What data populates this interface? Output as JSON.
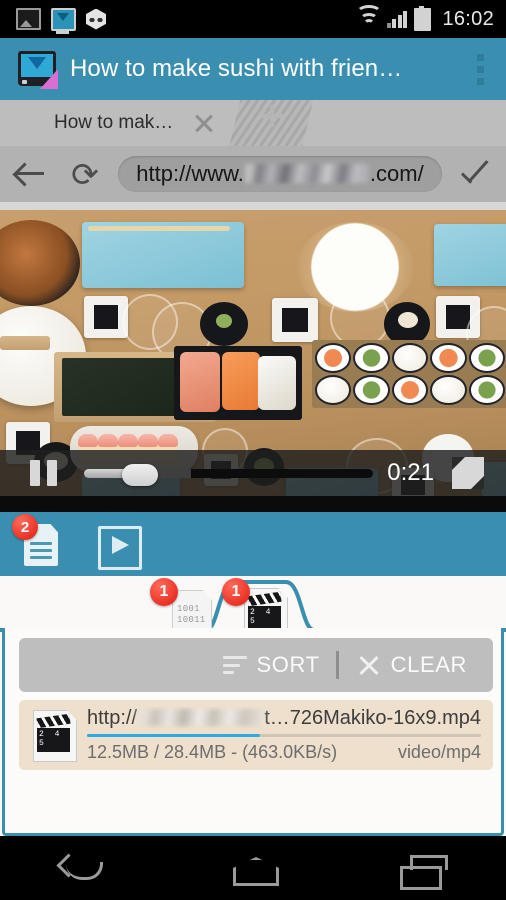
{
  "status_bar": {
    "time": "16:02",
    "icons": [
      "photo-icon",
      "screen-recorder-icon",
      "hexagon-face-icon",
      "wifi-icon",
      "signal-icon",
      "battery-icon"
    ]
  },
  "app_header": {
    "title": "How to make sushi with frien…",
    "logo_icon": "video-downloader-logo",
    "overflow_icon": "overflow-menu-icon",
    "bg_color": "#3a8fb0"
  },
  "browser": {
    "tab": {
      "label": "How to mak…",
      "close_icon": "close-icon"
    },
    "new_tab_icon": "plus-icon",
    "url_bar": {
      "back_icon": "back-arrow-icon",
      "reload_icon": "reload-icon",
      "url_prefix": "http://www.",
      "url_suffix": ".com/",
      "go_icon": "check-icon"
    }
  },
  "video": {
    "pause_icon": "pause-icon",
    "time": "0:21",
    "fullscreen_icon": "fullscreen-icon",
    "progress_percent": 17,
    "buffer_percent": 37
  },
  "action_bar": {
    "documents_icon": "document-list-icon",
    "documents_badge": "2",
    "play_icon": "play-box-icon"
  },
  "download_tabs": [
    {
      "icon": "binary-file-icon",
      "icon_text": "1001\n10011",
      "badge": "1",
      "active": false
    },
    {
      "icon": "movie-file-icon",
      "badge": "1",
      "active": true
    }
  ],
  "download_toolbar": {
    "sort_label": "SORT",
    "sort_icon": "sort-icon",
    "clear_label": "CLEAR",
    "clear_icon": "clear-x-icon"
  },
  "downloads": [
    {
      "icon": "movie-file-icon",
      "url_prefix": "http://",
      "url_suffix": "t…726Makiko-16x9.mp4",
      "progress_percent": 44,
      "progress_color": "#2eaae0",
      "size_text": "12.5MB / 28.4MB - (463.0KB/s)",
      "mime_type": "video/mp4"
    }
  ],
  "nav_bar": {
    "back_icon": "android-back-icon",
    "home_icon": "android-home-icon",
    "recents_icon": "android-recents-icon"
  }
}
